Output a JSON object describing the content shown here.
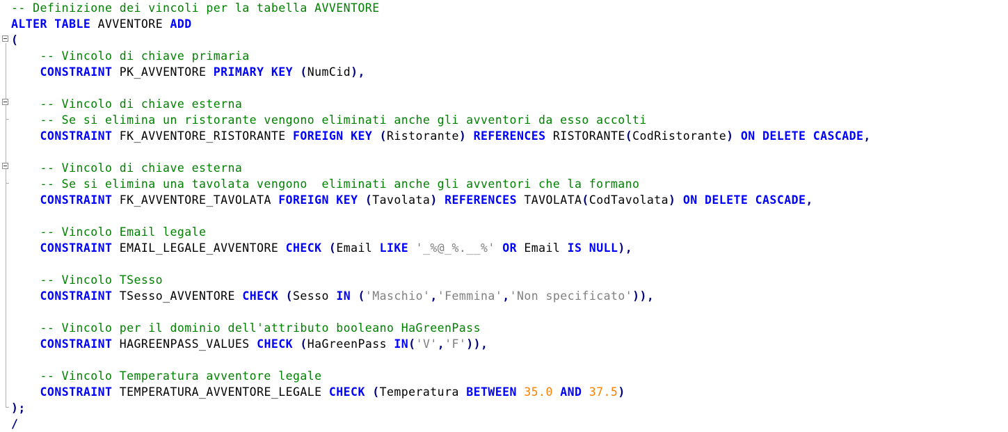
{
  "colors": {
    "comment": "#008000",
    "keyword": "#0000ff",
    "punctuation": "#000080",
    "identifier": "#000000",
    "string": "#808080",
    "number": "#ff8000",
    "background": "#ffffff"
  },
  "lines": [
    [
      {
        "c": "c",
        "t": "-- Definizione dei vincoli per la tabella AVVENTORE"
      }
    ],
    [
      {
        "c": "k",
        "t": "ALTER TABLE"
      },
      {
        "c": "t",
        "t": " AVVENTORE "
      },
      {
        "c": "k",
        "t": "ADD"
      }
    ],
    [
      {
        "c": "p",
        "t": "("
      }
    ],
    [
      {
        "c": "c",
        "t": "    -- Vincolo di chiave primaria"
      }
    ],
    [
      {
        "c": "t",
        "t": "    "
      },
      {
        "c": "k",
        "t": "CONSTRAINT"
      },
      {
        "c": "t",
        "t": " PK_AVVENTORE "
      },
      {
        "c": "k",
        "t": "PRIMARY KEY"
      },
      {
        "c": "t",
        "t": " "
      },
      {
        "c": "p",
        "t": "("
      },
      {
        "c": "t",
        "t": "NumCid"
      },
      {
        "c": "p",
        "t": "),"
      }
    ],
    [],
    [
      {
        "c": "c",
        "t": "    -- Vincolo di chiave esterna"
      }
    ],
    [
      {
        "c": "c",
        "t": "    -- Se si elimina un ristorante vengono eliminati anche gli avventori da esso accolti"
      }
    ],
    [
      {
        "c": "t",
        "t": "    "
      },
      {
        "c": "k",
        "t": "CONSTRAINT"
      },
      {
        "c": "t",
        "t": " FK_AVVENTORE_RISTORANTE "
      },
      {
        "c": "k",
        "t": "FOREIGN KEY"
      },
      {
        "c": "t",
        "t": " "
      },
      {
        "c": "p",
        "t": "("
      },
      {
        "c": "t",
        "t": "Ristorante"
      },
      {
        "c": "p",
        "t": ")"
      },
      {
        "c": "t",
        "t": " "
      },
      {
        "c": "k",
        "t": "REFERENCES"
      },
      {
        "c": "t",
        "t": " RISTORANTE"
      },
      {
        "c": "p",
        "t": "("
      },
      {
        "c": "t",
        "t": "CodRistorante"
      },
      {
        "c": "p",
        "t": ")"
      },
      {
        "c": "t",
        "t": " "
      },
      {
        "c": "k",
        "t": "ON DELETE CASCADE"
      },
      {
        "c": "p",
        "t": ","
      }
    ],
    [],
    [
      {
        "c": "c",
        "t": "    -- Vincolo di chiave esterna"
      }
    ],
    [
      {
        "c": "c",
        "t": "    -- Se si elimina una tavolata vengono  eliminati anche gli avventori che la formano"
      }
    ],
    [
      {
        "c": "t",
        "t": "    "
      },
      {
        "c": "k",
        "t": "CONSTRAINT"
      },
      {
        "c": "t",
        "t": " FK_AVVENTORE_TAVOLATA "
      },
      {
        "c": "k",
        "t": "FOREIGN KEY"
      },
      {
        "c": "t",
        "t": " "
      },
      {
        "c": "p",
        "t": "("
      },
      {
        "c": "t",
        "t": "Tavolata"
      },
      {
        "c": "p",
        "t": ")"
      },
      {
        "c": "t",
        "t": " "
      },
      {
        "c": "k",
        "t": "REFERENCES"
      },
      {
        "c": "t",
        "t": " TAVOLATA"
      },
      {
        "c": "p",
        "t": "("
      },
      {
        "c": "t",
        "t": "CodTavolata"
      },
      {
        "c": "p",
        "t": ")"
      },
      {
        "c": "t",
        "t": " "
      },
      {
        "c": "k",
        "t": "ON DELETE CASCADE"
      },
      {
        "c": "p",
        "t": ","
      }
    ],
    [],
    [
      {
        "c": "c",
        "t": "    -- Vincolo Email legale"
      }
    ],
    [
      {
        "c": "t",
        "t": "    "
      },
      {
        "c": "k",
        "t": "CONSTRAINT"
      },
      {
        "c": "t",
        "t": " EMAIL_LEGALE_AVVENTORE "
      },
      {
        "c": "k",
        "t": "CHECK"
      },
      {
        "c": "t",
        "t": " "
      },
      {
        "c": "p",
        "t": "("
      },
      {
        "c": "t",
        "t": "Email "
      },
      {
        "c": "k",
        "t": "LIKE"
      },
      {
        "c": "t",
        "t": " "
      },
      {
        "c": "s",
        "t": "'_%@_%.__%'"
      },
      {
        "c": "t",
        "t": " "
      },
      {
        "c": "k",
        "t": "OR"
      },
      {
        "c": "t",
        "t": " Email "
      },
      {
        "c": "k",
        "t": "IS NULL"
      },
      {
        "c": "p",
        "t": "),"
      }
    ],
    [],
    [
      {
        "c": "c",
        "t": "    -- Vincolo TSesso"
      }
    ],
    [
      {
        "c": "t",
        "t": "    "
      },
      {
        "c": "k",
        "t": "CONSTRAINT"
      },
      {
        "c": "t",
        "t": " TSesso_AVVENTORE "
      },
      {
        "c": "k",
        "t": "CHECK"
      },
      {
        "c": "t",
        "t": " "
      },
      {
        "c": "p",
        "t": "("
      },
      {
        "c": "t",
        "t": "Sesso "
      },
      {
        "c": "k",
        "t": "IN"
      },
      {
        "c": "t",
        "t": " "
      },
      {
        "c": "p",
        "t": "("
      },
      {
        "c": "s",
        "t": "'Maschio'"
      },
      {
        "c": "p",
        "t": ","
      },
      {
        "c": "s",
        "t": "'Femmina'"
      },
      {
        "c": "p",
        "t": ","
      },
      {
        "c": "s",
        "t": "'Non specificato'"
      },
      {
        "c": "p",
        "t": ")),"
      }
    ],
    [],
    [
      {
        "c": "c",
        "t": "    -- Vincolo per il dominio dell'attributo booleano HaGreenPass"
      }
    ],
    [
      {
        "c": "t",
        "t": "    "
      },
      {
        "c": "k",
        "t": "CONSTRAINT"
      },
      {
        "c": "t",
        "t": " HAGREENPASS_VALUES "
      },
      {
        "c": "k",
        "t": "CHECK"
      },
      {
        "c": "t",
        "t": " "
      },
      {
        "c": "p",
        "t": "("
      },
      {
        "c": "t",
        "t": "HaGreenPass "
      },
      {
        "c": "k",
        "t": "IN"
      },
      {
        "c": "p",
        "t": "("
      },
      {
        "c": "s",
        "t": "'V'"
      },
      {
        "c": "p",
        "t": ","
      },
      {
        "c": "s",
        "t": "'F'"
      },
      {
        "c": "p",
        "t": ")),"
      }
    ],
    [],
    [
      {
        "c": "c",
        "t": "    -- Vincolo Temperatura avventore legale"
      }
    ],
    [
      {
        "c": "t",
        "t": "    "
      },
      {
        "c": "k",
        "t": "CONSTRAINT"
      },
      {
        "c": "t",
        "t": " TEMPERATURA_AVVENTORE_LEGALE "
      },
      {
        "c": "k",
        "t": "CHECK"
      },
      {
        "c": "t",
        "t": " "
      },
      {
        "c": "p",
        "t": "("
      },
      {
        "c": "t",
        "t": "Temperatura "
      },
      {
        "c": "k",
        "t": "BETWEEN"
      },
      {
        "c": "t",
        "t": " "
      },
      {
        "c": "n",
        "t": "35.0"
      },
      {
        "c": "t",
        "t": " "
      },
      {
        "c": "k",
        "t": "AND"
      },
      {
        "c": "t",
        "t": " "
      },
      {
        "c": "n",
        "t": "37.5"
      },
      {
        "c": "p",
        "t": ")"
      }
    ],
    [
      {
        "c": "p",
        "t": ");"
      }
    ],
    [
      {
        "c": "p",
        "t": "/"
      }
    ]
  ]
}
